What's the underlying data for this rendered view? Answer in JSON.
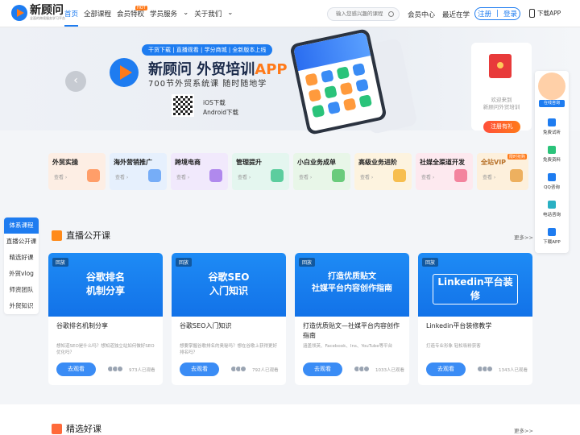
{
  "brand": {
    "name": "新顾问",
    "tagline": "全面的跨境服务学习平台"
  },
  "nav": {
    "items": [
      "首页",
      "全部课程",
      "会员特权",
      "学员服务",
      "关于我们"
    ],
    "hot": "HOT"
  },
  "search": {
    "placeholder": "输入您感兴趣的课程"
  },
  "header_links": [
    "会员中心",
    "最近在学"
  ],
  "auth": {
    "register": "注册",
    "sep": "|",
    "login": "登录"
  },
  "download": "下载APP",
  "banner": {
    "tag": "干货下载 | 直播观看 | 学分商城 | 全新版本上线",
    "title": "新顾问 外贸培训",
    "title_app": "APP",
    "subtitle": "700节外贸系统课 随时随地学",
    "ios": "iOS下载",
    "android": "Android下载",
    "arrow": "‹"
  },
  "promo": {
    "line1": "欢迎来到",
    "line2": "新顾问外贸培训",
    "button": "注册有礼"
  },
  "categories": [
    {
      "name": "外贸实操",
      "view": "查看 ›",
      "bg": "#fdeee4",
      "icon": "#ff8a4a"
    },
    {
      "name": "海外营销推广",
      "view": "查看 ›",
      "bg": "#e6f0fd",
      "icon": "#5a9cf5"
    },
    {
      "name": "跨境电商",
      "view": "查看 ›",
      "bg": "#f1e9fc",
      "icon": "#a070e8"
    },
    {
      "name": "管理提升",
      "view": "查看 ›",
      "bg": "#e4f6ef",
      "icon": "#3ac38a"
    },
    {
      "name": "小白业务成单",
      "view": "查看 ›",
      "bg": "#e8f6e8",
      "icon": "#4ac060"
    },
    {
      "name": "高级业务进阶",
      "view": "查看 ›",
      "bg": "#fdf3df",
      "icon": "#f5b02a"
    },
    {
      "name": "社媒全渠道开发",
      "view": "查看 ›",
      "bg": "#fde9ef",
      "icon": "#f06a8a"
    },
    {
      "name": "全站VIP",
      "view": "查看 ›",
      "bg": "#fdf0dc",
      "icon": "#e8a040",
      "badge": "限时抢购"
    }
  ],
  "side_nav": [
    "体系课程",
    "直播公开课",
    "精选好课",
    "外贸vlog",
    "师资团队",
    "外贸知识"
  ],
  "live": {
    "title": "直播公开课",
    "more": "更多>>",
    "cards": [
      {
        "tag": "回放",
        "thumb": "谷歌排名\n机制分享",
        "title": "谷歌排名机制分享",
        "desc": "想知道SEO是什么吗？想知道独立站如何做好SEO优化吗？",
        "button": "去观看",
        "viewers": "973人已观看"
      },
      {
        "tag": "回放",
        "thumb": "谷歌SEO\n入门知识",
        "title": "谷歌SEO入门知识",
        "desc": "想要掌握谷歌排名的奥秘吗？想在谷歌上获得更好排名吗？",
        "button": "去观看",
        "viewers": "792人已观看"
      },
      {
        "tag": "回放",
        "thumb": "打造优质贴文\n社媒平台内容创作指南",
        "title": "打造优质贴文—社媒平台内容创作指南",
        "desc": "涵盖领英、Facebook、Ins、YouTube等平台",
        "button": "去观看",
        "viewers": "1033人已观看"
      },
      {
        "tag": "回放",
        "thumb": "Linkedin平台装修",
        "title": "Linkedin平台装修教学",
        "desc": "打造专业形象 轻松吸粉获客",
        "button": "去观看",
        "viewers": "1343人已观看"
      }
    ]
  },
  "picks": {
    "title": "精选好课",
    "more": "更多>>"
  },
  "float_bar": {
    "agent": "在线咨询",
    "items": [
      "免费试听",
      "免费资料",
      "QQ咨询",
      "电话咨询",
      "下载APP"
    ]
  }
}
